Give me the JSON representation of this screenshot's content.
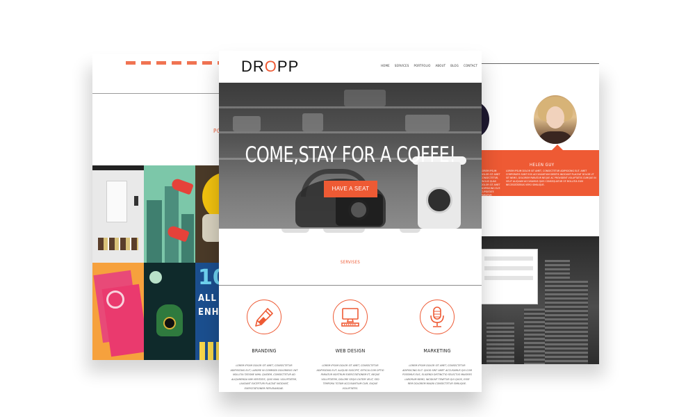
{
  "front": {
    "logo": {
      "part1": "DR",
      "part2": "O",
      "part3": "PP"
    },
    "nav": [
      "HOME",
      "SERVICES",
      "PORTFOLIO",
      "ABOUT",
      "BLOG",
      "CONTACT"
    ],
    "hero": {
      "title": "COME,STAY FOR A COFFE!",
      "button": "HAVE A SEAT"
    },
    "services": {
      "title": "SERVISES",
      "items": [
        {
          "name": "BRANDING",
          "icon": "pencil-icon",
          "desc": "LOREM IPSUM DOLOR SIT AMET, CONSECTETUR ADIPISICING ELIT, LABORE IN COMMODI DOLORIBUS UNT NOLLITIA TATIONE NIHIL QUIDEM, CONSECTETUR AD ALIQUMENDA NIM VERITATIS, QUIS NIHIL VOLUPTATEM, LAUDANT EXCEPTURI PLACEAT INCIDUNT, EXERCITATIONEM REPUDIANDAE."
        },
        {
          "name": "WEB DESIGN",
          "icon": "computer-icon",
          "desc": "LOREM IPSUM DOLOR SIT AMET, CONSECTETUR ADIPISICING ELIT. ALIQUID SUSCIPIT, OFFICIA CUM OPTIO PARIATUR NOSTRUM EXERCITATIONEM ET, NEQUE VOLUPTATEM, DOLORE SEQUI OUTEM VELIT, SED TEMPORA TOTAM ACCUSANTIUM CUM, EAQUE VOLUPTATES."
        },
        {
          "name": "MARKETING",
          "icon": "microphone-icon",
          "desc": "LOREM IPSUM DOLOR SIT AMET, CONSECTETUR ADIPISICING ELIT. QUOD SINT AMET ACCUSAMUS QUI CUM POSSIMUS EUS, ELIGENDI DISTINCTIO SELECTUS MAIORES LABORUM NEMO, INCIDUNT TENETUR QUI QUOS, ESSE REM DOLOREM MAGNI CONSECTETUR SIMILIQUE."
        }
      ]
    }
  },
  "back_left": {
    "section_label": "PORTF"
  },
  "back_right": {
    "testimonial": {
      "name": "HELEN GUY",
      "quote": "LOREM IPSUM DOLOR SIT AMET, CONSECTETUR ADIPISICING ELIT. AMET CORPORATIS SUNT EOS ACCUSANTIUM DEBITIS INCIDUNT PLACEAT DOLOR UT SIT NEMO, DOLOREM PARIATUR NEQUE AC PROVIDENT VOLUPTATES CUMQUE IN VELIT ALIQUAM ACCUSAMUS QUIS CONSEQUATUR OF MOLLITIA EUM NECESSITATIBUS VERO SIMILIQUE.",
      "quote_left": "LOREM IPSUM DOLOR SIT AMET CONSECTETUR, FACILIS QUAS DOLOR SIT AMET ADIPISICING ELIT. CUPIDITATE PARIATUR DOLOREM NEQUE."
    }
  },
  "colors": {
    "accent": "#ee5a34",
    "text": "#222222",
    "hero_overlay": "#555555"
  }
}
